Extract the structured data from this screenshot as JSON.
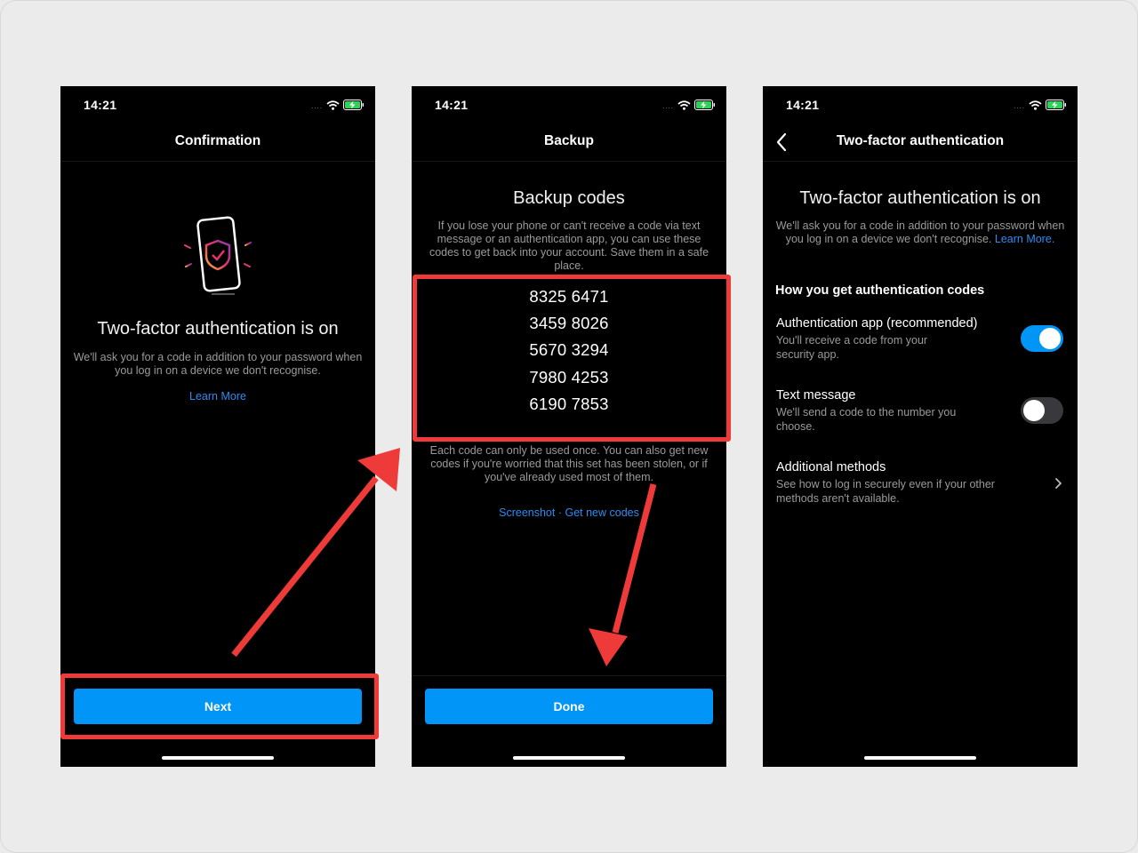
{
  "status": {
    "time": "14:21",
    "dots": "...."
  },
  "screen1": {
    "title": "Confirmation",
    "heading": "Two-factor authentication is on",
    "body": "We'll ask you for a code in addition to your password when you log in on a device we don't recognise.",
    "link": "Learn More",
    "button": "Next"
  },
  "screen2": {
    "title": "Backup",
    "heading": "Backup codes",
    "body": "If you lose your phone or can't receive a code via text message or an authentication app, you can use these codes to get back into your account. Save them in a safe place.",
    "codes": [
      "8325 6471",
      "3459 8026",
      "5670 3294",
      "7980 4253",
      "6190 7853"
    ],
    "note": "Each code can only be used once. You can also get new codes if you're worried that this set has been stolen, or if you've already used most of them.",
    "link_screenshot": "Screenshot",
    "link_separator": " · ",
    "link_new": "Get new codes",
    "button": "Done"
  },
  "screen3": {
    "title": "Two-factor authentication",
    "heading": "Two-factor authentication is on",
    "body": "We'll ask you for a code in addition to your password when you log in on a device we don't recognise.",
    "link": "Learn More",
    "link_suffix": ".",
    "section": "How you get authentication codes",
    "options": [
      {
        "title": "Authentication app (recommended)",
        "desc": "You'll receive a code from your security app.",
        "enabled": true
      },
      {
        "title": "Text message",
        "desc": "We'll send a code to the number you choose.",
        "enabled": false
      },
      {
        "title": "Additional methods",
        "desc": "See how to log in securely even if your other methods aren't available."
      }
    ]
  },
  "colors": {
    "accent": "#0095f6",
    "link": "#2d8cf0",
    "highlight": "#ee3a38",
    "background": "#000000"
  },
  "icons": [
    "wifi-icon",
    "battery-charging-icon",
    "back-chevron-icon",
    "phone-shield-illustration",
    "chevron-right-icon"
  ]
}
